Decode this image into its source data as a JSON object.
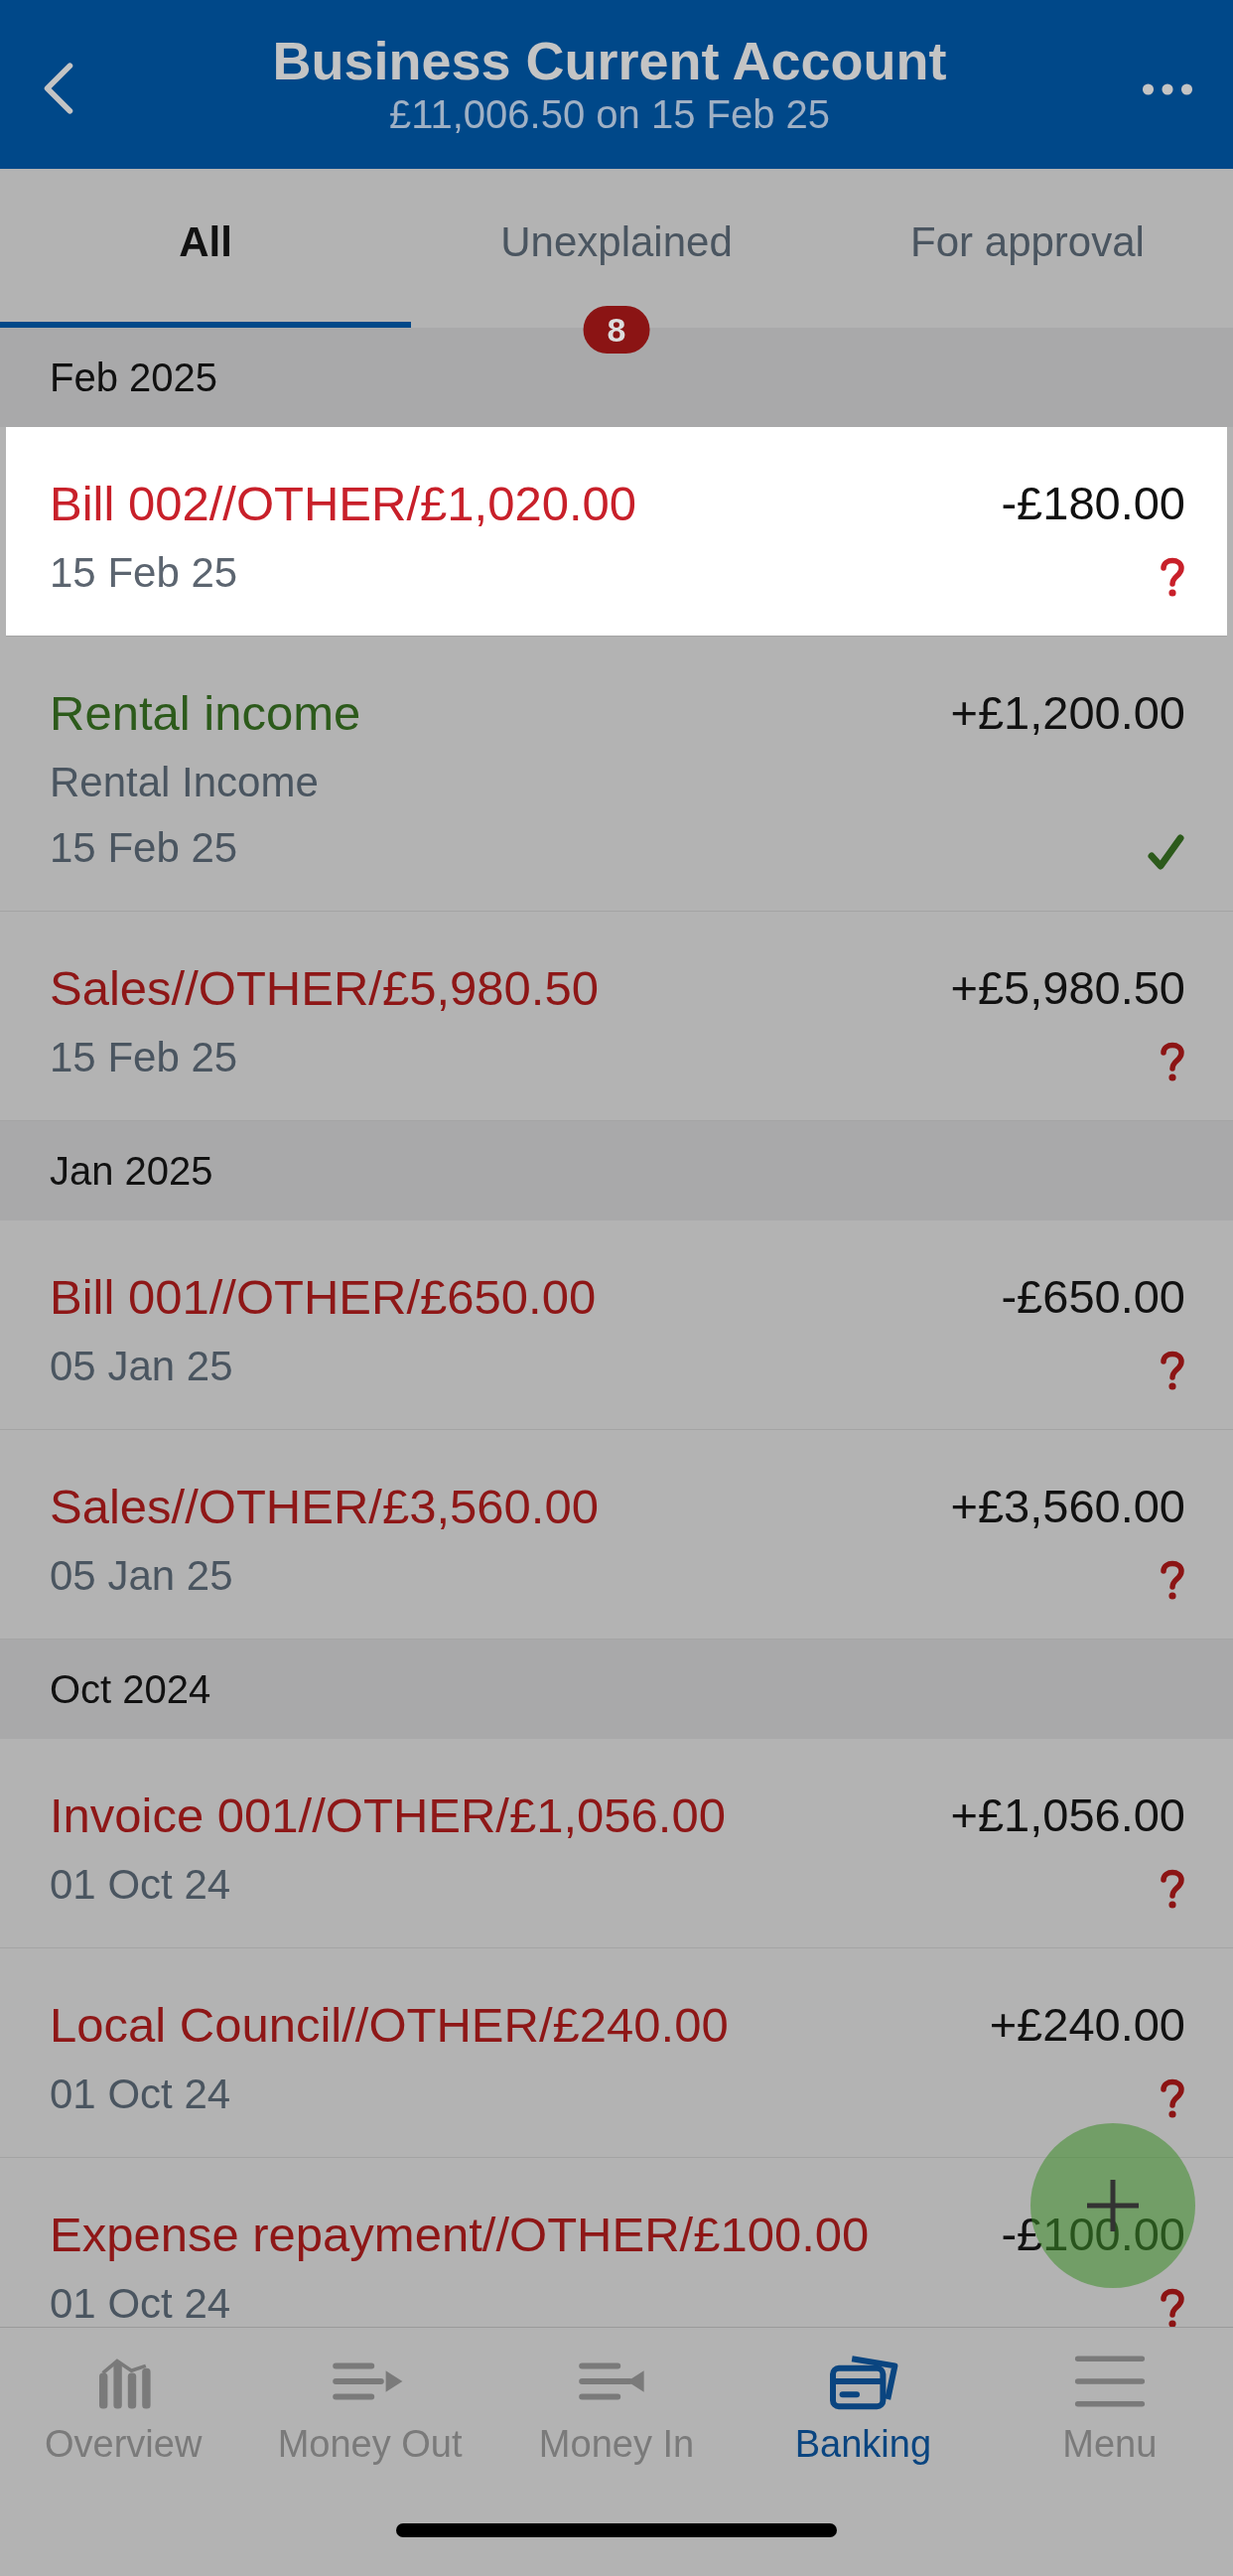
{
  "header": {
    "title": "Business Current Account",
    "subtitle": "£11,006.50 on 15 Feb 25"
  },
  "tabs": [
    {
      "label": "All",
      "selected": true
    },
    {
      "label": "Unexplained",
      "selected": false,
      "badge": "8"
    },
    {
      "label": "For approval",
      "selected": false
    }
  ],
  "sections": [
    {
      "label": "Feb 2025",
      "transactions": [
        {
          "title": "Bill 002//OTHER/£1,020.00",
          "date": "15 Feb 25",
          "amount": "-£180.00",
          "explained": false,
          "highlighted": true
        },
        {
          "title": "Rental income",
          "detail": "Rental Income",
          "date": "15 Feb 25",
          "amount": "+£1,200.00",
          "explained": true,
          "highlighted": false
        },
        {
          "title": "Sales//OTHER/£5,980.50",
          "date": "15 Feb 25",
          "amount": "+£5,980.50",
          "explained": false,
          "highlighted": false
        }
      ]
    },
    {
      "label": "Jan 2025",
      "transactions": [
        {
          "title": "Bill 001//OTHER/£650.00",
          "date": "05 Jan 25",
          "amount": "-£650.00",
          "explained": false,
          "highlighted": false
        },
        {
          "title": "Sales//OTHER/£3,560.00",
          "date": "05 Jan 25",
          "amount": "+£3,560.00",
          "explained": false,
          "highlighted": false
        }
      ]
    },
    {
      "label": "Oct 2024",
      "transactions": [
        {
          "title": "Invoice 001//OTHER/£1,056.00",
          "date": "01 Oct 24",
          "amount": "+£1,056.00",
          "explained": false,
          "highlighted": false
        },
        {
          "title": "Local Council//OTHER/£240.00",
          "date": "01 Oct 24",
          "amount": "+£240.00",
          "explained": false,
          "highlighted": false
        },
        {
          "title": "Expense repayment//OTHER/£100.00",
          "date": "01 Oct 24",
          "amount": "-£100.00",
          "explained": false,
          "highlighted": false
        }
      ]
    }
  ],
  "nav": [
    {
      "label": "Overview",
      "selected": false
    },
    {
      "label": "Money Out",
      "selected": false
    },
    {
      "label": "Money In",
      "selected": false
    },
    {
      "label": "Banking",
      "selected": true
    },
    {
      "label": "Menu",
      "selected": false
    }
  ]
}
